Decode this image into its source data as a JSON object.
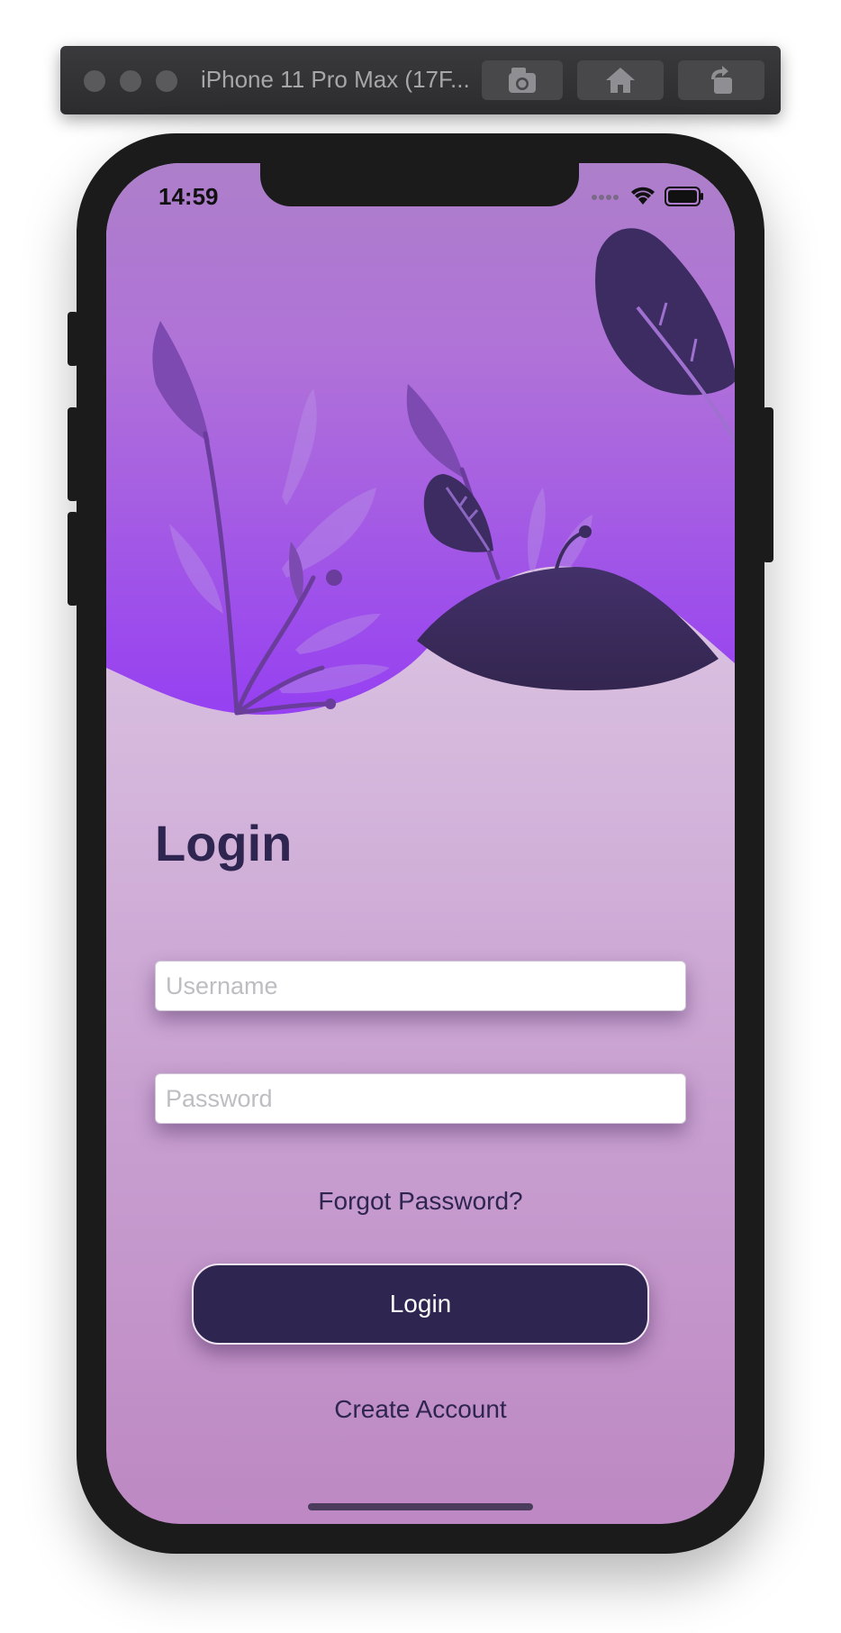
{
  "simulator": {
    "title": "iPhone 11 Pro Max (17F..."
  },
  "status_bar": {
    "time": "14:59"
  },
  "login": {
    "heading": "Login",
    "username_placeholder": "Username",
    "password_placeholder": "Password",
    "forgot_password": "Forgot Password?",
    "login_button": "Login",
    "create_account": "Create Account"
  },
  "colors": {
    "hero_top": "#ac7fcc",
    "hero_bottom": "#9747f0",
    "dark_plant": "#3c2c62",
    "text_dark": "#2e2550",
    "button_bg": "#2e2550"
  },
  "icons": {
    "screenshot": "camera-icon",
    "home": "house-icon",
    "rotate": "rotate-icon",
    "signal": "cellular-signal-icon",
    "wifi": "wifi-icon",
    "battery": "battery-icon"
  }
}
